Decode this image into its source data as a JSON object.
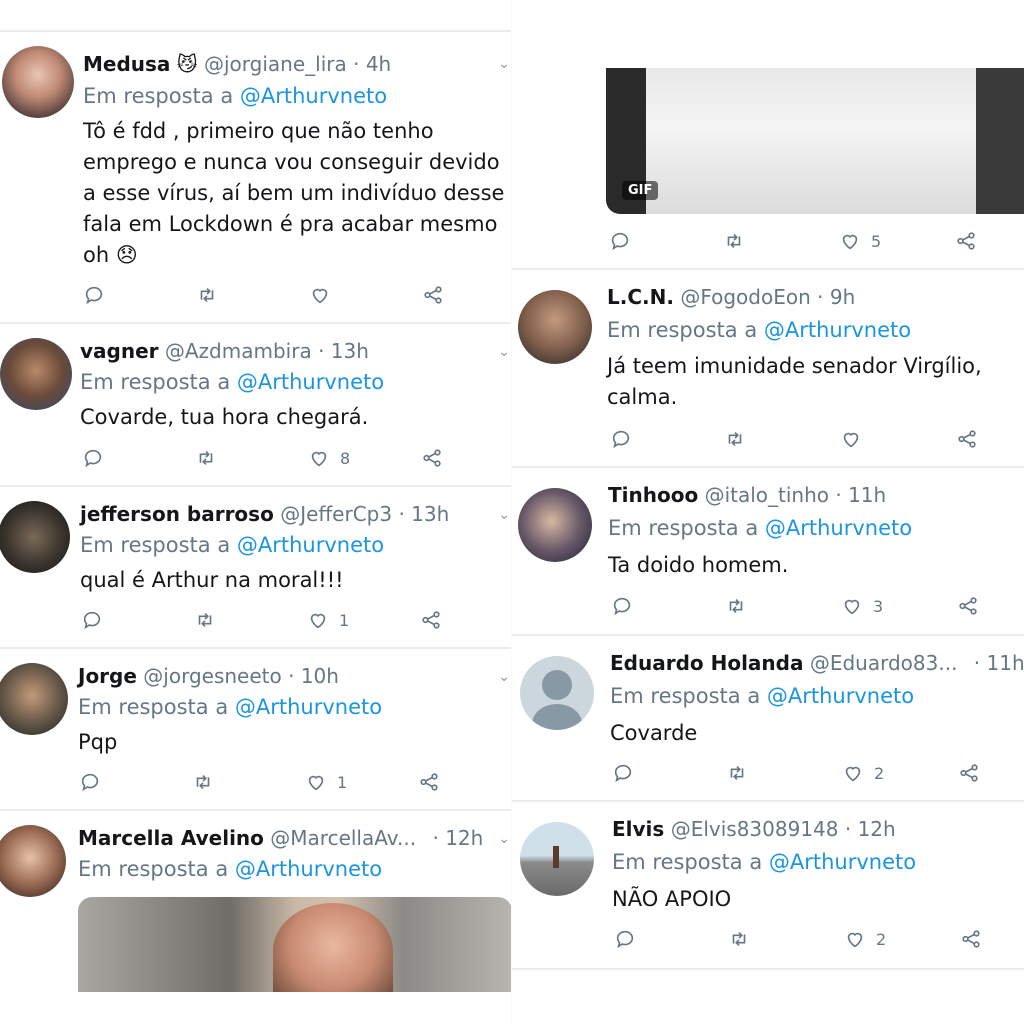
{
  "mention": "@Arthurvneto",
  "reply_prefix": "Em resposta a",
  "gif_label": "GIF",
  "colors": {
    "accent": "#1b95e0",
    "secondary_text": "#657786",
    "divider": "#e8ecef"
  },
  "left_column": {
    "tweets": [
      {
        "name": "Medusa",
        "emoji": "😼",
        "handle": "@jorgiane_lira",
        "time": "· 4h",
        "text": "Tô é fdd , primeiro que não tenho emprego e nunca vou conseguir devido a esse vírus, aí bem um indivíduo desse fala em Lockdown é pra acabar mesmo oh 😞",
        "likes": ""
      },
      {
        "name": "vagner",
        "handle": "@Azdmambira",
        "time": "· 13h",
        "text": "Covarde, tua hora chegará.",
        "likes": "8"
      },
      {
        "name": "jefferson barroso",
        "handle": "@JefferCp3",
        "time": "· 13h",
        "text": "qual é Arthur na moral!!!",
        "likes": "1"
      },
      {
        "name": "Jorge",
        "handle": "@jorgesneeto",
        "time": "· 10h",
        "text": "Pqp",
        "likes": "1"
      },
      {
        "name": "Marcella Avelino",
        "handle": "@MarcellaAv...",
        "time": "· 12h",
        "text": "",
        "likes": ""
      }
    ]
  },
  "right_column": {
    "top_tweet": {
      "likes": "5"
    },
    "tweets": [
      {
        "name": "L.C.N.",
        "handle": "@FogodoEon",
        "time": "· 9h",
        "text": "Já teem imunidade senador Virgílio, calma.",
        "likes": ""
      },
      {
        "name": "Tinhooo",
        "handle": "@italo_tinho",
        "time": "· 11h",
        "text": "Ta doido homem.",
        "likes": "3"
      },
      {
        "name": "Eduardo Holanda",
        "handle": "@Eduardo83...",
        "time": "· 11h",
        "text": "Covarde",
        "likes": "2"
      },
      {
        "name": "Elvis",
        "handle": "@Elvis83089148",
        "time": "· 12h",
        "text": "NÃO APOIO",
        "likes": "2"
      }
    ]
  }
}
